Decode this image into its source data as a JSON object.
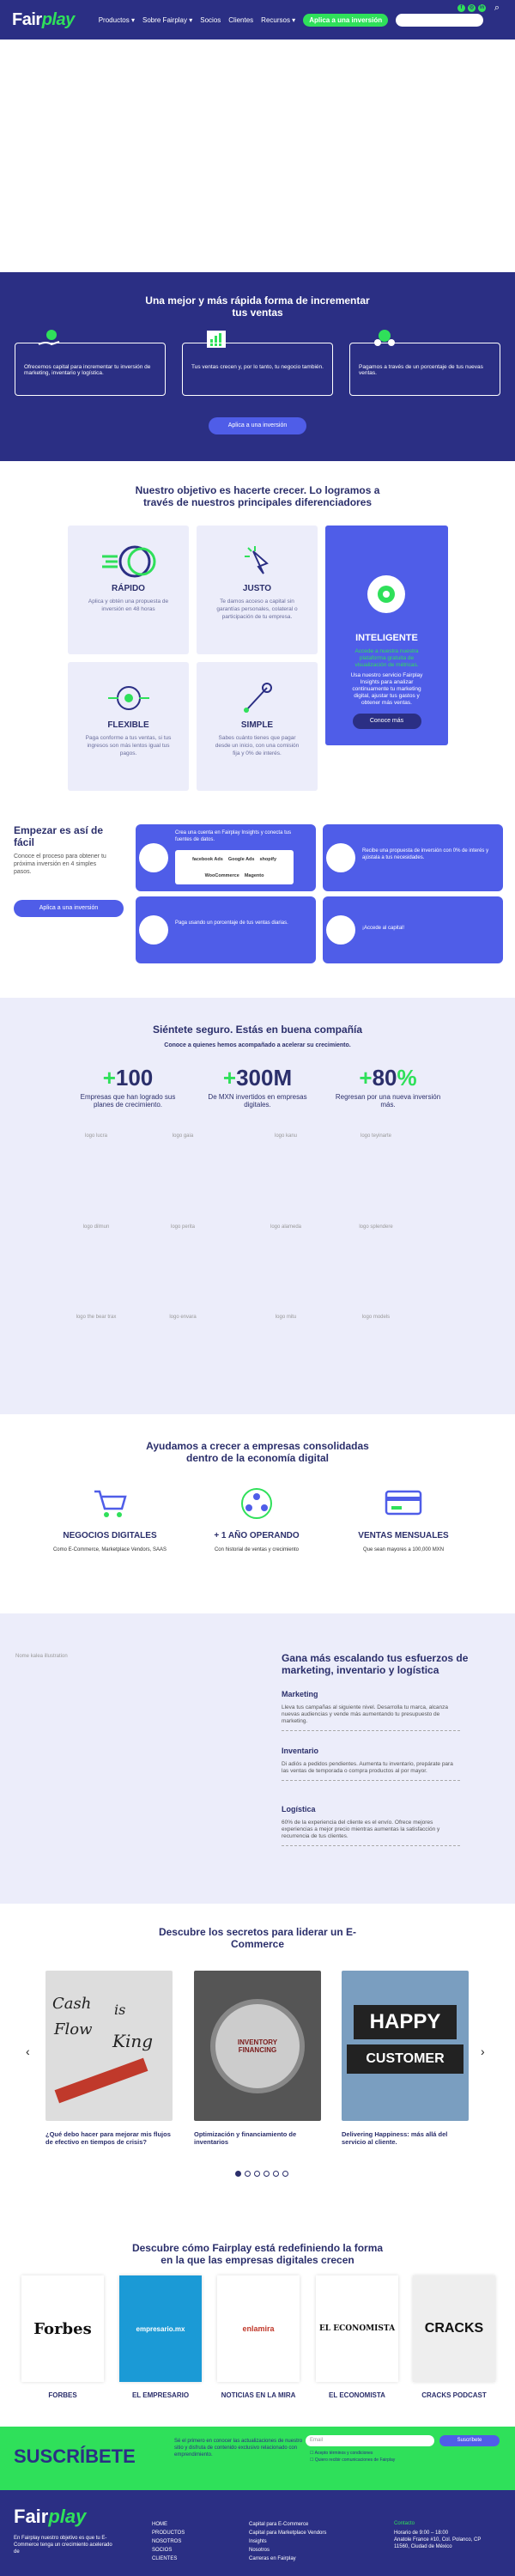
{
  "header": {
    "logo_a": "Fair",
    "logo_b": "play",
    "nav": [
      "Productos ▾",
      "Sobre Fairplay ▾",
      "Socios",
      "Clientes",
      "Recursos ▾"
    ],
    "cta": "Aplica a una inversión",
    "cta2": "Login Fairplay Insights"
  },
  "benefits": {
    "title": "Una mejor y más rápida forma de incrementar tus ventas",
    "cards": [
      "Ofrecemos capital para incrementar tu inversión de marketing, inventario y logística.",
      "Tus ventas crecen y, por lo tanto, tu negocio también.",
      "Pagamos a través de un porcentaje de tus nuevas ventas."
    ],
    "button": "Aplica a una inversión"
  },
  "objective": {
    "title": "Nuestro objetivo es hacerte crecer. Lo logramos a través de nuestros principales diferenciadores",
    "cards": [
      {
        "t": "RÁPIDO",
        "d": "Aplica y obtén una propuesta de inversión en 48 horas"
      },
      {
        "t": "JUSTO",
        "d": "Te damos acceso a capital sin garantías personales, colateral o participación de tu empresa."
      },
      {
        "t": "FLEXIBLE",
        "d": "Paga conforme a tus ventas, si tus ingresos son más lentos igual tus pagos."
      },
      {
        "t": "SIMPLE",
        "d": "Sabes cuánto tienes que pagar desde un inicio, con una comisión fija y 0% de interés."
      }
    ],
    "intel": {
      "t": "INTELIGENTE",
      "g": "Accede a nuestra nuestra plataforma gratuita de visualización de métricas.",
      "d": "Usa nuestro servicio Fairplay Insights para analizar continuamente tu marketing digital, ajustar tus gastos y obtener más ventas.",
      "b": "Conoce más"
    }
  },
  "start": {
    "title": "Empezar es así de fácil",
    "desc": "Conoce el proceso para obtener tu próxima inversión en 4 simples pasos.",
    "button": "Aplica a una inversión",
    "steps": [
      "Crea una cuenta en Fairplay Insights y conecta tus fuentes de datos.",
      "Recibe una propuesta de inversión con 0% de interés y ajústala a tus necesidades.",
      "Paga usando un porcentaje de tus ventas diarias.",
      "¡Accede al capital!"
    ],
    "logos": [
      "facebook Ads",
      "Google Ads",
      "shopify",
      "WooCommerce",
      "Magento"
    ]
  },
  "trust": {
    "title": "Siéntete seguro. Estás en buena compañía",
    "sub": "Conoce a quienes hemos acompañado a acelerar su crecimiento.",
    "stats": [
      {
        "n": "100",
        "p": "+",
        "s": "",
        "l": "Empresas que han logrado sus planes de crecimiento."
      },
      {
        "n": "300M",
        "p": "+",
        "s": "",
        "l": "De MXN invertidos en empresas digitales."
      },
      {
        "n": "80",
        "p": "+",
        "s": "%",
        "l": "Regresan por una nueva inversión más."
      }
    ],
    "logos": [
      "logo lucra",
      "logo gaia",
      "logo kanu",
      "logo teyinarte",
      "logo dilmun",
      "logo perita",
      "logo alameda",
      "logo splendere",
      "logo the bear trax",
      "logo envara",
      "logo mitu",
      "logo models"
    ]
  },
  "consolidated": {
    "title": "Ayudamos a crecer a empresas consolidadas dentro de la economía digital",
    "items": [
      {
        "t": "NEGOCIOS DIGITALES",
        "d": "Como E-Commerce, Marketplace Vendors, SAAS"
      },
      {
        "t": "+ 1 AÑO OPERANDO",
        "d": "Con historial de ventas y crecimiento"
      },
      {
        "t": "VENTAS MENSUALES",
        "d": "Que sean mayores a 100,000 MXN"
      }
    ]
  },
  "grow": {
    "ill": "Nome kalea illustration",
    "title": "Gana más escalando tus esfuerzos de marketing, inventario y logística",
    "items": [
      {
        "t": "Marketing",
        "d": "Lleva tus campañas al siguiente nivel. Desarrolla tu marca, alcanza nuevas audiencias y vende más aumentando tu presupuesto de marketing."
      },
      {
        "t": "Inventario",
        "d": "Di adiós a pedidos pendientes. Aumenta tu inventario, prepárate para las ventas de temporada o compra productos al por mayor."
      },
      {
        "t": "Logística",
        "d": "60% de la experiencia del cliente es el envío. Ofrece mejores experiencias a mejor precio mientras aumentas la satisfacción y recurrencia de tus clientes."
      }
    ]
  },
  "blog": {
    "title": "Descubre los secretos para liderar un E-Commerce",
    "posts": [
      "¿Qué debo hacer para mejorar mis flujos de efectivo en tiempos de crisis?",
      "Optimización y financiamiento de inventarios",
      "Delivering Happiness: más allá del servicio al cliente."
    ],
    "img1a": "Cash",
    "img1b": "Flow",
    "img1c": "is",
    "img1d": "King",
    "img2": "INVENTORY FINANCING",
    "img3a": "HAPPY",
    "img3b": "CUSTOMER"
  },
  "press": {
    "title": "Descubre cómo Fairplay está redefiniendo la forma en la que las empresas digitales crecen",
    "items": [
      {
        "logo": "Forbes",
        "n": "FORBES"
      },
      {
        "logo": "empresario.mx",
        "n": "EL EMPRESARIO"
      },
      {
        "logo": "enlamira",
        "n": "NOTICIAS EN LA MIRA"
      },
      {
        "logo": "EL ECONOMISTA",
        "n": "EL ECONOMISTA"
      },
      {
        "logo": "CRACKS",
        "n": "CRACKS PODCAST"
      }
    ]
  },
  "subscribe": {
    "title": "SUSCRÍBETE",
    "desc": "Sé el primero en conocer las actualizaciones de nuestro sitio y disfruta de contenido exclusivo relacionado con emprendimiento.",
    "placeholder": "Email",
    "button": "Suscríbete",
    "c1": "Acepto términos y condiciones",
    "c2": "Quiero recibir comunicaciones de Fairplay"
  },
  "footer": {
    "desc": "En Fairplay nuestro objetivo es que tu E-Commerce tenga un crecimiento acelerado de",
    "c1": [
      "HOME",
      "PRODUCTOS",
      "NOSOTROS",
      "SOCIOS",
      "CLIENTES"
    ],
    "c2": [
      "Capital para E-Commerce",
      "Capital para Marketplace Vendors",
      "Insights",
      "Nosotros",
      "Carreras en Fairplay"
    ],
    "c3": [
      "Contacto",
      "Horario de 9:00 – 18:00",
      "Anatole France #10, Col. Polanco, CP 11560, Ciudad de México"
    ]
  }
}
